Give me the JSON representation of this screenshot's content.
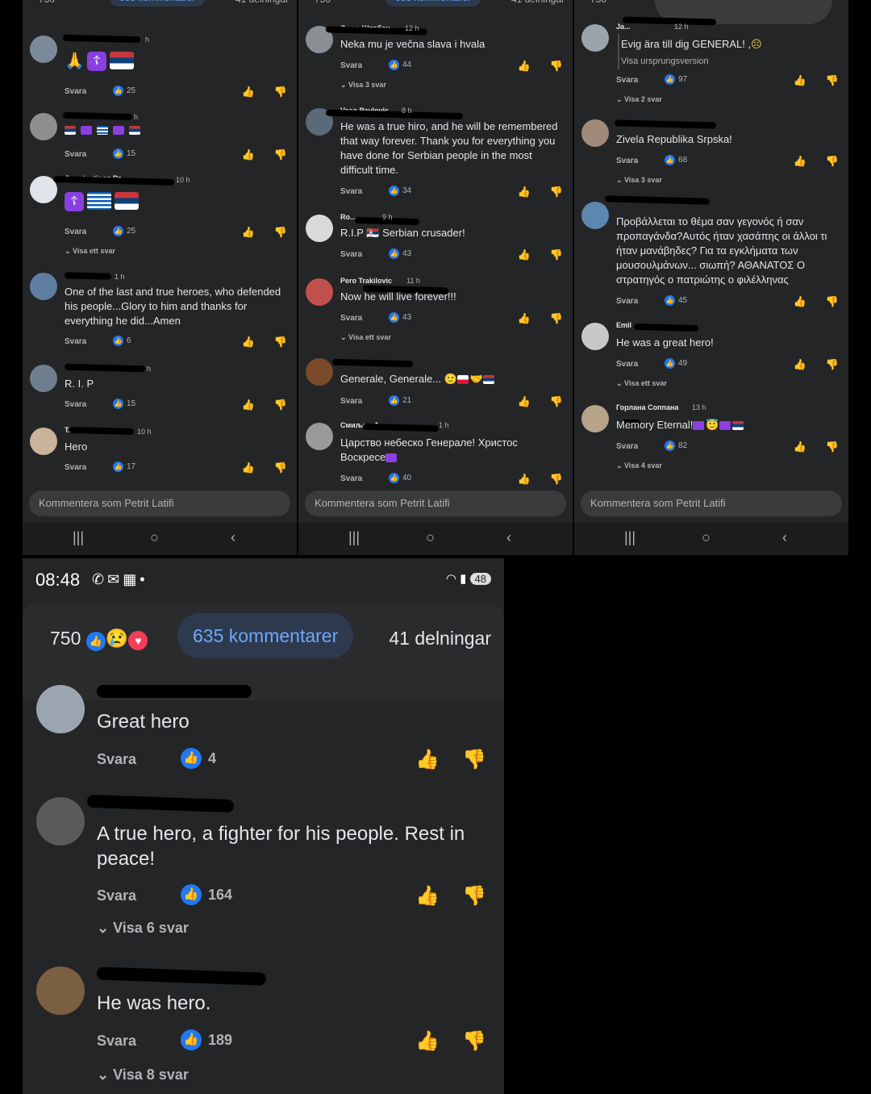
{
  "header": {
    "reaction_count": "750",
    "comments_tab": "635 kommentarer",
    "shares": "41 delningar"
  },
  "labels": {
    "reply": "Svara",
    "comment_placeholder": "Kommentera som Petrit Latifi",
    "see_original": "Visa ursprungsversion"
  },
  "status_bar": {
    "time": "08:48",
    "battery": "48"
  },
  "panel1": [
    {
      "name": "",
      "time": "h",
      "text": "",
      "likes": "25",
      "replies": ""
    },
    {
      "name": "",
      "time": "h",
      "text": "",
      "likes": "15",
      "replies": ""
    },
    {
      "name": "Constantinos Dr...",
      "time": "10 h",
      "text": "",
      "likes": "25",
      "replies": "Visa ett svar"
    },
    {
      "name": "",
      "time": "1 h",
      "text": "One of the last and true heroes, who defended his people...Glory to him and thanks for everything he did...Amen",
      "likes": "6",
      "replies": ""
    },
    {
      "name": "",
      "time": "h",
      "text": "R. I. P",
      "likes": "15",
      "replies": ""
    },
    {
      "name": "T...",
      "time": "10 h",
      "text": "Hero",
      "likes": "17",
      "replies": ""
    }
  ],
  "panel2": [
    {
      "name": "Саша Штрбац",
      "time": "12 h",
      "text": "Neka mu je večna slava i hvala",
      "likes": "44",
      "replies": "Visa 3 svar"
    },
    {
      "name": "Vaso Pavlovic",
      "time": "8 h",
      "text": "He was a true hiro, and he will be remembered that way forever. Thank you for everything you have done for Serbian people in the most difficult time.",
      "likes": "34",
      "replies": ""
    },
    {
      "name": "Ro...",
      "time": "9 h",
      "text": "R.I.P 🇷🇸 Serbian crusader!",
      "likes": "43",
      "replies": ""
    },
    {
      "name": "Pero Trakilovic",
      "time": "11 h",
      "text": "Now he will live forever!!!",
      "likes": "43",
      "replies": "Visa ett svar"
    },
    {
      "name": "",
      "time": "",
      "text": "Generale, Generale...",
      "likes": "21",
      "replies": ""
    },
    {
      "name": "Смиљанић",
      "time": "1 h",
      "text": "Царство небеско Генерале! Христос Воскресе",
      "likes": "40",
      "replies": ""
    }
  ],
  "panel3": [
    {
      "name": "Ja...",
      "time": "12 h",
      "text": "Evig ära till dig GENERAL! ,",
      "likes": "97",
      "replies": "Visa 2 svar"
    },
    {
      "name": "",
      "time": "",
      "text": "Zivela Republika Srpska!",
      "likes": "68",
      "replies": "Visa 3 svar"
    },
    {
      "name": "",
      "time": "",
      "text": "Προβάλλεται το θέμα σαν γεγονός ή σαν προπαγάνδα?Αυτός ήταν χασάπης οι άλλοι τι ήταν μανάβηδες? Για τα εγκλήματα των μουσουλμάνων... σιωπή? ΑΘΑΝΑΤΟΣ Ο στρατηγός ο πατριώτης ο φιλέλληνας",
      "likes": "45",
      "replies": ""
    },
    {
      "name": "Emil",
      "time": "",
      "text": "He was a great hero!",
      "likes": "49",
      "replies": "Visa ett svar"
    },
    {
      "name": "Горлана Соппана",
      "time": "13 h",
      "text": "Memory Eternal!",
      "likes": "82",
      "replies": "Visa 4 svar"
    }
  ],
  "big": [
    {
      "text": "Great hero",
      "likes": "4",
      "replies": ""
    },
    {
      "text": "A true hero, a fighter for his people. Rest in peace!",
      "likes": "164",
      "replies": "Visa 6 svar"
    },
    {
      "text": "He was hero.",
      "likes": "189",
      "replies": "Visa 8 svar"
    }
  ]
}
